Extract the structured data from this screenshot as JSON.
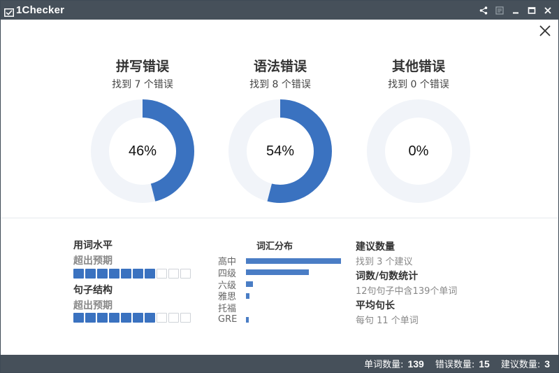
{
  "app": {
    "title": "1Checker"
  },
  "colors": {
    "titlebar": "#46505a",
    "accent": "#3a72c0",
    "track": "#f1f4f9"
  },
  "errors": [
    {
      "title": "拼写错误",
      "found": "找到 7 个错误",
      "percent_label": "46%",
      "percent": 46
    },
    {
      "title": "语法错误",
      "found": "找到 8 个错误",
      "percent_label": "54%",
      "percent": 54
    },
    {
      "title": "其他错误",
      "found": "找到 0 个错误",
      "percent_label": "0%",
      "percent": 0
    }
  ],
  "levels": {
    "word": {
      "label": "用词水平",
      "value": "超出预期",
      "filled": 7,
      "total": 10
    },
    "sentence": {
      "label": "句子结构",
      "value": "超出预期",
      "filled": 7,
      "total": 10
    }
  },
  "vocab": {
    "title": "词汇分布",
    "rows": [
      {
        "label": "高中",
        "fraction": 1.0
      },
      {
        "label": "四级",
        "fraction": 0.66
      },
      {
        "label": "六级",
        "fraction": 0.07
      },
      {
        "label": "雅思",
        "fraction": 0.04
      },
      {
        "label": "托福",
        "fraction": 0.0
      },
      {
        "label": "GRE",
        "fraction": 0.03
      }
    ]
  },
  "stats": {
    "suggestions": {
      "title": "建议数量",
      "value": "找到 3 个建议"
    },
    "counts": {
      "title": "词数/句数统计",
      "value": "12句句子中含139个单词"
    },
    "avg": {
      "title": "平均句长",
      "value": "每句 11 个单词"
    }
  },
  "status": {
    "words_label": "单词数量:",
    "words": "139",
    "errors_label": "错误数量:",
    "errors": "15",
    "suggest_label": "建议数量:",
    "suggest": "3"
  }
}
